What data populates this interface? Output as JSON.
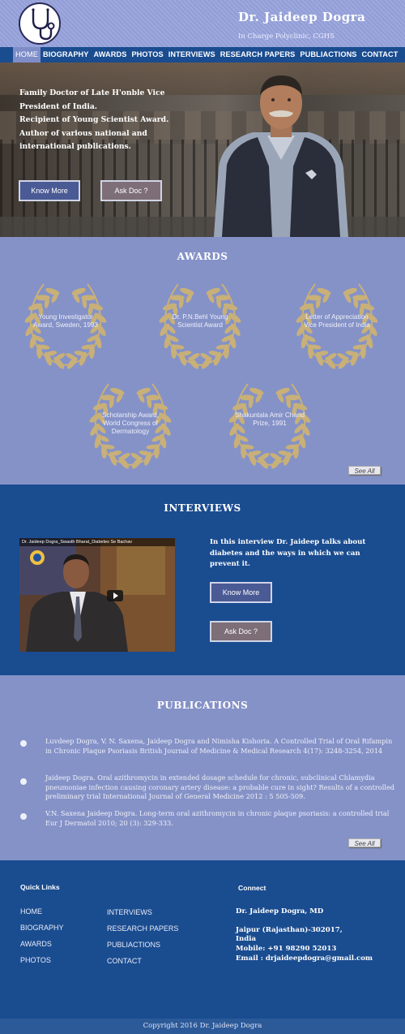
{
  "header": {
    "title": "Dr. Jaideep Dogra",
    "subtitle": "In Charge Polyclinic, CGHS",
    "logo_icon": "stethoscope-icon"
  },
  "nav": {
    "items": [
      "HOME",
      "BIOGRAPHY",
      "AWARDS",
      "PHOTOS",
      "INTERVIEWS",
      "RESEARCH PAPERS",
      "PUBLIACTIONS",
      "CONTACT"
    ],
    "active": "HOME"
  },
  "hero": {
    "lines": [
      "Family Doctor of Late H'onble Vice President of India.",
      "Recipient of Young Scientist Award.",
      "Author of various national and international publications."
    ],
    "know_more": "Know More",
    "ask_doc": "Ask Doc ?"
  },
  "awards": {
    "title": "AWARDS",
    "items": [
      "Young Investigator Award, Sweden, 1993",
      "Dr. P.N.Behl Young Scientist Award",
      "Letter of Appreciation Vice President of India",
      "Scholarship Award, World Congress of Dermatology",
      "Shakuntala Amir Chand Prize, 1991"
    ],
    "see_all": "See All"
  },
  "interviews": {
    "title": "INTERVIEWS",
    "video_title": "Dr. Jaideep Dogra_Swasth Bharat_Diabetes Se Bachav",
    "description": "In this interview Dr. Jaideep talks about diabetes and the ways in which we can prevent it.",
    "know_more": "Know More",
    "ask_doc": "Ask Doc ?"
  },
  "publications": {
    "title": "PUBLICATIONS",
    "items": [
      "Luvdeep Dogra, V. N. Saxena, Jaideep Dogra and Nimisha Kishoria. A Controlled Trial of Oral Rifampin in Chronic Plaque Psoriasis British Journal of Medicine &  Medical Research 4(17): 3248-3254, 2014",
      "Jaideep Dogra. Oral azithromycin in  extended dosage schedule for chronic, subclinical Chlamydia pneumoniae infection causing coronary artery disease: a probable cure in sight? Results of  a controlled preliminary trial International Journal of General Medicine 2012 : 5 505-509.",
      "V.N. Saxena Jaideep Dogra. Long-term  oral azithromycin in chronic plaque psoriasis: a controlled trial Eur J  Dermatol 2010; 20 (3): 329-333."
    ],
    "see_all": "See All"
  },
  "footer": {
    "quick_links_title": "Quick Links",
    "col1": [
      "HOME",
      "BIOGRAPHY",
      "AWARDS",
      "PHOTOS"
    ],
    "col2": [
      "INTERVIEWS",
      "RESEARCH PAPERS",
      "PUBLIACTIONS",
      "CONTACT"
    ],
    "connect_title": "Connect",
    "name": "Dr. Jaideep Dogra, MD",
    "address1": "Jaipur (Rajasthan)-302017,",
    "address2": "India",
    "mobile": "Mobile: +91 98290 52013",
    "email": "Email : drjaideepdogra@gmail.com",
    "copyright": "Copyright 2016 Dr. Jaideep Dogra"
  },
  "colors": {
    "navy": "#1a4c90",
    "periwinkle": "#8592c7",
    "laurel": "#c8b078"
  }
}
